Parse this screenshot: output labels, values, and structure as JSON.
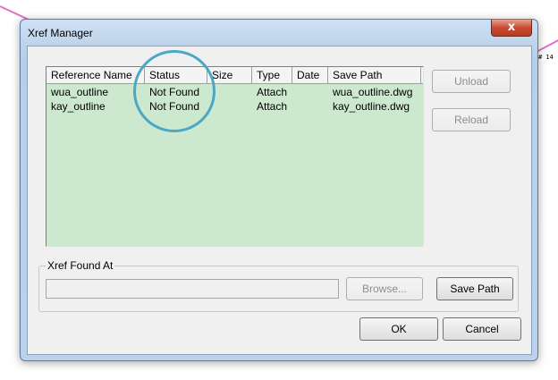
{
  "dialog": {
    "title": "Xref Manager",
    "close_glyph": "x"
  },
  "xref_table": {
    "columns": [
      "Reference Name",
      "Status",
      "Size",
      "Type",
      "Date",
      "Save Path"
    ],
    "rows": [
      {
        "name": "wua_outline",
        "status": "Not Found",
        "size": "",
        "type": "Attach",
        "date": "",
        "save_path": "wua_outline.dwg"
      },
      {
        "name": "kay_outline",
        "status": "Not Found",
        "size": "",
        "type": "Attach",
        "date": "",
        "save_path": "kay_outline.dwg"
      }
    ]
  },
  "side_buttons": {
    "unload": "Unload",
    "reload": "Reload"
  },
  "found_at": {
    "label": "Xref Found At",
    "value": "",
    "browse": "Browse...",
    "save_path": "Save Path"
  },
  "footer": {
    "ok": "OK",
    "cancel": "Cancel"
  },
  "background": {
    "cad_annotation": "# 14"
  },
  "colors": {
    "list_background": "#cce8cf",
    "highlight_circle": "#4aa8c4",
    "close_button": "#c84a32"
  }
}
